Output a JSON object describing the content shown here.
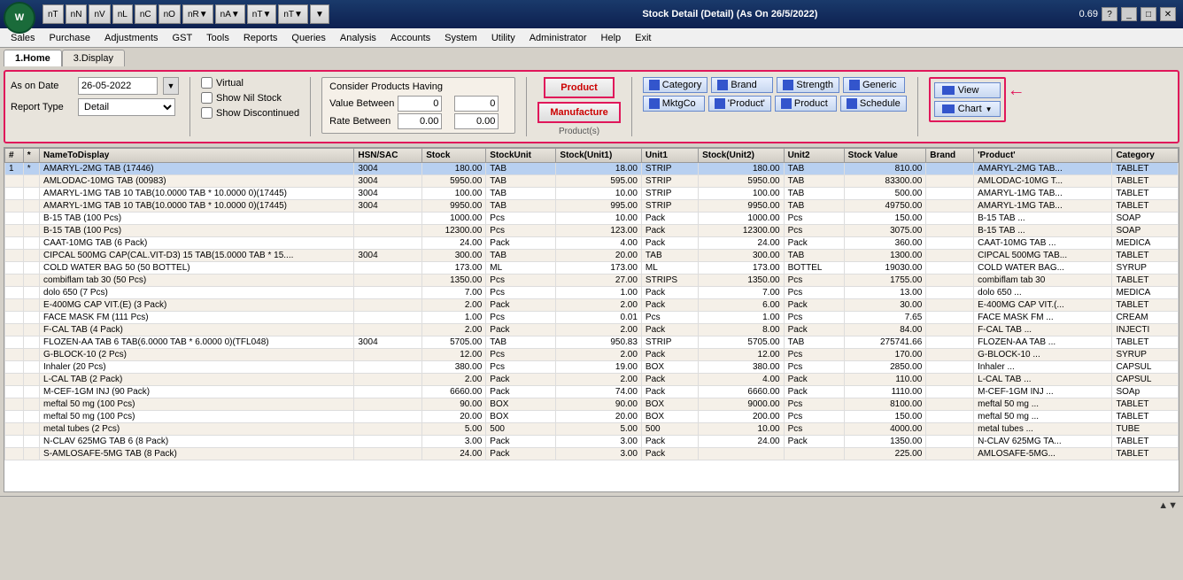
{
  "app": {
    "title": "Stock Detail (Detail)  (As On 26/5/2022)",
    "version": "0.69"
  },
  "menubar": {
    "items": [
      "Sales",
      "Purchase",
      "Adjustments",
      "GST",
      "Tools",
      "Reports",
      "Queries",
      "Analysis",
      "Accounts",
      "System",
      "Utility",
      "Administrator",
      "Help",
      "Exit"
    ]
  },
  "tabs": [
    {
      "id": "home",
      "label": "1.Home",
      "active": true
    },
    {
      "id": "display",
      "label": "3.Display",
      "active": false
    }
  ],
  "filter": {
    "as_on_date_label": "As on Date",
    "as_on_date_value": "26-05-2022",
    "report_type_label": "Report Type",
    "report_type_value": "Detail",
    "virtual_label": "Virtual",
    "show_nil_label": "Show Nil Stock",
    "show_discontinued_label": "Show Discontinued",
    "consider_title": "Consider Products Having",
    "value_between_label": "Value Between",
    "rate_between_label": "Rate Between",
    "value_from": "0",
    "value_to": "0",
    "rate_from": "0.00",
    "rate_to": "0.00",
    "product_btn": "Product",
    "manufacture_btn": "Manufacture",
    "products_label": "Product(s)"
  },
  "cat_buttons": [
    {
      "label": "Category"
    },
    {
      "label": "Brand"
    },
    {
      "label": "Strength"
    },
    {
      "label": "Generic"
    },
    {
      "label": "MktgCo"
    },
    {
      "label": "'Product'"
    },
    {
      "label": "Product"
    },
    {
      "label": "Schedule"
    }
  ],
  "view_buttons": [
    {
      "label": "View"
    },
    {
      "label": "Chart"
    }
  ],
  "table": {
    "columns": [
      "#",
      "*",
      "NameToDisplay",
      "HSN/SAC",
      "Stock",
      "StockUnit",
      "Stock(Unit1)",
      "Unit1",
      "Stock(Unit2)",
      "Unit2",
      "Stock Value",
      "Brand",
      "'Product'",
      "Category"
    ],
    "rows": [
      {
        "num": "1",
        "star": "*",
        "name": "AMARYL-2MG TAB          (17446)",
        "hsn": "3004",
        "stock": "180.00",
        "unit": "TAB",
        "su1": "18.00",
        "u1": "STRIP",
        "su2": "180.00",
        "u2": "TAB",
        "sv": "810.00",
        "brand": "",
        "product": "AMARYL-2MG TAB...",
        "category": "TABLET",
        "selected": true
      },
      {
        "num": "",
        "star": "",
        "name": "AMLODAC-10MG TAB       (00983)",
        "hsn": "3004",
        "stock": "5950.00",
        "unit": "TAB",
        "su1": "595.00",
        "u1": "STRIP",
        "su2": "5950.00",
        "u2": "TAB",
        "sv": "83300.00",
        "brand": "",
        "product": "AMLODAC-10MG T...",
        "category": "TABLET"
      },
      {
        "num": "",
        "star": "",
        "name": "AMARYL-1MG TAB 10 TAB(10.0000 TAB * 10.0000 0)(17445)",
        "hsn": "3004",
        "stock": "100.00",
        "unit": "TAB",
        "su1": "10.00",
        "u1": "STRIP",
        "su2": "100.00",
        "u2": "TAB",
        "sv": "500.00",
        "brand": "",
        "product": "AMARYL-1MG TAB...",
        "category": "TABLET"
      },
      {
        "num": "",
        "star": "",
        "name": "AMARYL-1MG TAB 10 TAB(10.0000 TAB * 10.0000 0)(17445)",
        "hsn": "3004",
        "stock": "9950.00",
        "unit": "TAB",
        "su1": "995.00",
        "u1": "STRIP",
        "su2": "9950.00",
        "u2": "TAB",
        "sv": "49750.00",
        "brand": "",
        "product": "AMARYL-1MG TAB...",
        "category": "TABLET"
      },
      {
        "num": "",
        "star": "",
        "name": "B-15 TAB (100 Pcs)",
        "hsn": "",
        "stock": "1000.00",
        "unit": "Pcs",
        "su1": "10.00",
        "u1": "Pack",
        "su2": "1000.00",
        "u2": "Pcs",
        "sv": "150.00",
        "brand": "",
        "product": "B-15 TAB       ...",
        "category": "SOAP"
      },
      {
        "num": "",
        "star": "",
        "name": "B-15 TAB (100 Pcs)",
        "hsn": "",
        "stock": "12300.00",
        "unit": "Pcs",
        "su1": "123.00",
        "u1": "Pack",
        "su2": "12300.00",
        "u2": "Pcs",
        "sv": "3075.00",
        "brand": "",
        "product": "B-15 TAB       ...",
        "category": "SOAP"
      },
      {
        "num": "",
        "star": "",
        "name": "CAAT-10MG TAB (6 Pack)",
        "hsn": "",
        "stock": "24.00",
        "unit": "Pack",
        "su1": "4.00",
        "u1": "Pack",
        "su2": "24.00",
        "u2": "Pack",
        "sv": "360.00",
        "brand": "",
        "product": "CAAT-10MG TAB  ...",
        "category": "MEDICA"
      },
      {
        "num": "",
        "star": "",
        "name": "CIPCAL 500MG CAP(CAL.VIT-D3) 15 TAB(15.0000 TAB * 15....",
        "hsn": "3004",
        "stock": "300.00",
        "unit": "TAB",
        "su1": "20.00",
        "u1": "TAB",
        "su2": "300.00",
        "u2": "TAB",
        "sv": "1300.00",
        "brand": "",
        "product": "CIPCAL 500MG TAB...",
        "category": "TABLET"
      },
      {
        "num": "",
        "star": "",
        "name": "COLD WATER BAG 50 (50 BOTTEL)",
        "hsn": "",
        "stock": "173.00",
        "unit": "ML",
        "su1": "173.00",
        "u1": "ML",
        "su2": "173.00",
        "u2": "BOTTEL",
        "sv": "19030.00",
        "brand": "",
        "product": "COLD WATER BAG...",
        "category": "SYRUP"
      },
      {
        "num": "",
        "star": "",
        "name": "combiflam tab 30 (50 Pcs)",
        "hsn": "",
        "stock": "1350.00",
        "unit": "Pcs",
        "su1": "27.00",
        "u1": "STRIPS",
        "su2": "1350.00",
        "u2": "Pcs",
        "sv": "1755.00",
        "brand": "",
        "product": "combiflam tab 30",
        "category": "TABLET"
      },
      {
        "num": "",
        "star": "",
        "name": "dolo 650 (7 Pcs)",
        "hsn": "",
        "stock": "7.00",
        "unit": "Pcs",
        "su1": "1.00",
        "u1": "Pack",
        "su2": "7.00",
        "u2": "Pcs",
        "sv": "13.00",
        "brand": "",
        "product": "dolo 650       ...",
        "category": "MEDICA"
      },
      {
        "num": "",
        "star": "",
        "name": "E-400MG CAP VIT.(E) (3 Pack)",
        "hsn": "",
        "stock": "2.00",
        "unit": "Pack",
        "su1": "2.00",
        "u1": "Pack",
        "su2": "6.00",
        "u2": "Pack",
        "sv": "30.00",
        "brand": "",
        "product": "E-400MG CAP VIT.(... ",
        "category": "TABLET"
      },
      {
        "num": "",
        "star": "",
        "name": "FACE MASK  FM (111 Pcs)",
        "hsn": "",
        "stock": "1.00",
        "unit": "Pcs",
        "su1": "0.01",
        "u1": "Pcs",
        "su2": "1.00",
        "u2": "Pcs",
        "sv": "7.65",
        "brand": "",
        "product": "FACE MASK  FM  ...",
        "category": "CREAM"
      },
      {
        "num": "",
        "star": "",
        "name": "F-CAL TAB (4 Pack)",
        "hsn": "",
        "stock": "2.00",
        "unit": "Pack",
        "su1": "2.00",
        "u1": "Pack",
        "su2": "8.00",
        "u2": "Pack",
        "sv": "84.00",
        "brand": "",
        "product": "F-CAL TAB      ...",
        "category": "INJECTI"
      },
      {
        "num": "",
        "star": "",
        "name": "FLOZEN-AA TAB 6 TAB(6.0000 TAB * 6.0000 0)(TFL048)",
        "hsn": "3004",
        "stock": "5705.00",
        "unit": "TAB",
        "su1": "950.83",
        "u1": "STRIP",
        "su2": "5705.00",
        "u2": "TAB",
        "sv": "275741.66",
        "brand": "",
        "product": "FLOZEN-AA TAB  ...",
        "category": "TABLET"
      },
      {
        "num": "",
        "star": "",
        "name": "G-BLOCK-10 (2 Pcs)",
        "hsn": "",
        "stock": "12.00",
        "unit": "Pcs",
        "su1": "2.00",
        "u1": "Pack",
        "su2": "12.00",
        "u2": "Pcs",
        "sv": "170.00",
        "brand": "",
        "product": "G-BLOCK-10     ...",
        "category": "SYRUP"
      },
      {
        "num": "",
        "star": "",
        "name": "Inhaler (20 Pcs)",
        "hsn": "",
        "stock": "380.00",
        "unit": "Pcs",
        "su1": "19.00",
        "u1": "BOX",
        "su2": "380.00",
        "u2": "Pcs",
        "sv": "2850.00",
        "brand": "",
        "product": "Inhaler        ...",
        "category": "CAPSUL"
      },
      {
        "num": "",
        "star": "",
        "name": "L-CAL TAB (2 Pack)",
        "hsn": "",
        "stock": "2.00",
        "unit": "Pack",
        "su1": "2.00",
        "u1": "Pack",
        "su2": "4.00",
        "u2": "Pack",
        "sv": "110.00",
        "brand": "",
        "product": "L-CAL TAB      ...",
        "category": "CAPSUL"
      },
      {
        "num": "",
        "star": "",
        "name": "M-CEF-1GM INJ (90 Pack)",
        "hsn": "",
        "stock": "6660.00",
        "unit": "Pack",
        "su1": "74.00",
        "u1": "Pack",
        "su2": "6660.00",
        "u2": "Pack",
        "sv": "1110.00",
        "brand": "",
        "product": "M-CEF-1GM INJ  ...",
        "category": "SOAp"
      },
      {
        "num": "",
        "star": "",
        "name": "meftal 50 mg (100 Pcs)",
        "hsn": "",
        "stock": "90.00",
        "unit": "BOX",
        "su1": "90.00",
        "u1": "BOX",
        "su2": "9000.00",
        "u2": "Pcs",
        "sv": "8100.00",
        "brand": "",
        "product": "meftal 50 mg   ...",
        "category": "TABLET"
      },
      {
        "num": "",
        "star": "",
        "name": "meftal 50 mg (100 Pcs)",
        "hsn": "",
        "stock": "20.00",
        "unit": "BOX",
        "su1": "20.00",
        "u1": "BOX",
        "su2": "200.00",
        "u2": "Pcs",
        "sv": "150.00",
        "brand": "",
        "product": "meftal 50 mg   ...",
        "category": "TABLET"
      },
      {
        "num": "",
        "star": "",
        "name": "metal tubes (2 Pcs)",
        "hsn": "",
        "stock": "5.00",
        "unit": "500",
        "su1": "5.00",
        "u1": "500",
        "su2": "10.00",
        "u2": "Pcs",
        "sv": "4000.00",
        "brand": "",
        "product": "metal tubes    ...",
        "category": "TUBE"
      },
      {
        "num": "",
        "star": "",
        "name": "N-CLAV 625MG TAB  6 (8 Pack)",
        "hsn": "",
        "stock": "3.00",
        "unit": "Pack",
        "su1": "3.00",
        "u1": "Pack",
        "su2": "24.00",
        "u2": "Pack",
        "sv": "1350.00",
        "brand": "",
        "product": "N-CLAV 625MG TA...",
        "category": "TABLET"
      },
      {
        "num": "",
        "star": "",
        "name": "S-AMLOSAFE-5MG TAB (8 Pack)",
        "hsn": "",
        "stock": "24.00",
        "unit": "Pack",
        "su1": "3.00",
        "u1": "Pack",
        "su2": "",
        "u2": "",
        "sv": "225.00",
        "brand": "",
        "product": "AMLOSAFE-5MG...",
        "category": "TABLET"
      }
    ]
  }
}
